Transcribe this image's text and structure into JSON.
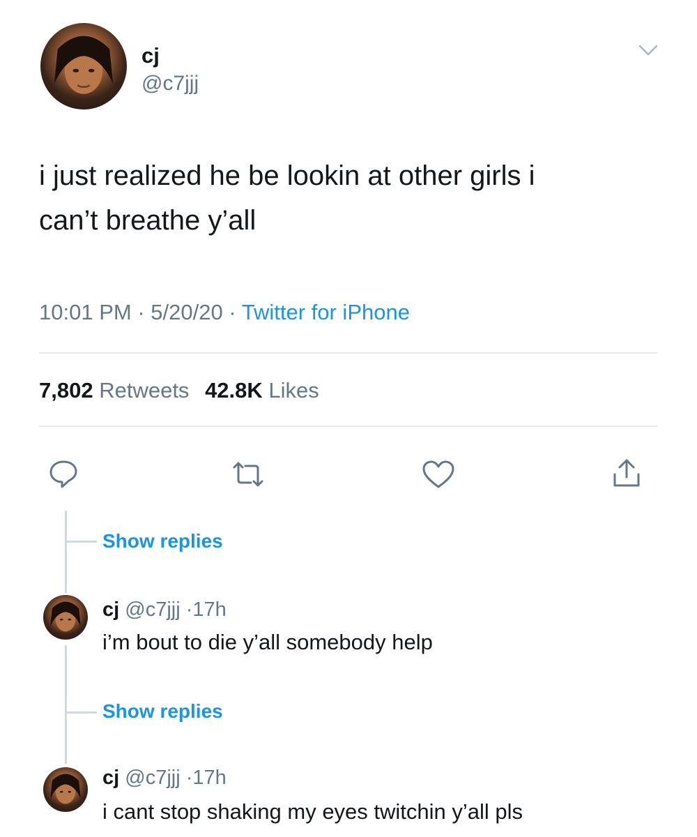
{
  "tweet": {
    "author": {
      "display_name": "cj",
      "handle": "@c7jjj",
      "avatar_icon": "profile-photo"
    },
    "text_line1": "i just realized he be lookin at other girls i",
    "text_line2": "can’t breathe y’all",
    "time": "10:01 PM",
    "date": "5/20/20",
    "separator": "·",
    "source": "Twitter for iPhone",
    "stats": {
      "retweets_count": "7,802",
      "retweets_label": "Retweets",
      "likes_count": "42.8K",
      "likes_label": "Likes"
    },
    "actions": {
      "reply_icon": "speech-bubble",
      "retweet_icon": "retweet-arrows",
      "like_icon": "heart",
      "share_icon": "share-arrow"
    },
    "menu_icon": "chevron-down"
  },
  "thread": {
    "show_replies_label": "Show replies",
    "replies": [
      {
        "display_name": "cj",
        "handle": "@c7jjj",
        "separator": "·",
        "time": "17h",
        "text": "i’m bout to die y’all somebody help"
      },
      {
        "display_name": "cj",
        "handle": "@c7jjj",
        "separator": "·",
        "time": "17h",
        "text": "i cant stop shaking my eyes twitchin y’all pls"
      }
    ]
  },
  "colors": {
    "text": "#14171a",
    "secondary": "#657786",
    "link": "#1b95e0",
    "divider": "#e6ecf0",
    "thread_line": "#cfd9de"
  }
}
